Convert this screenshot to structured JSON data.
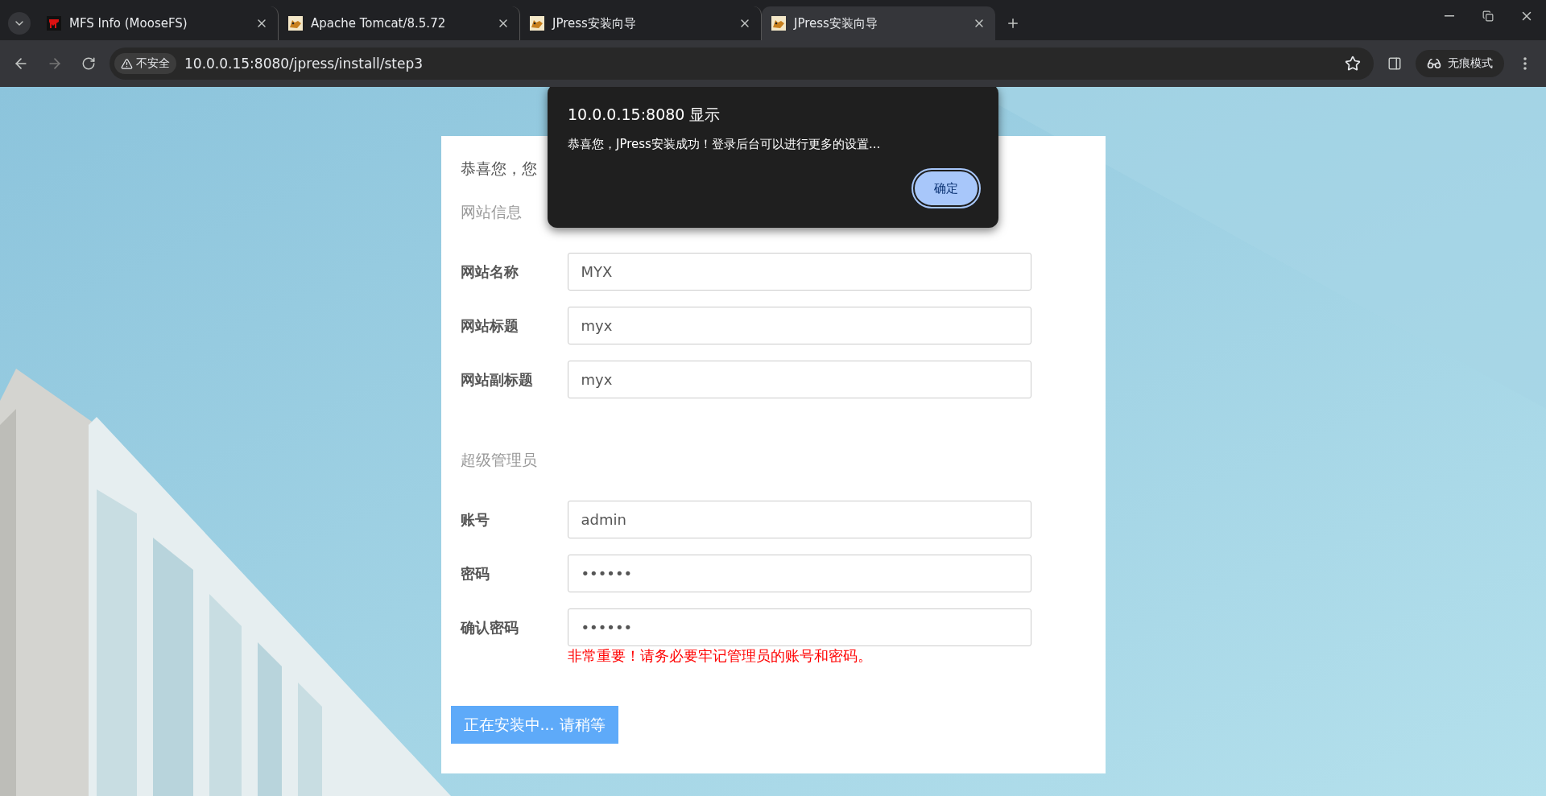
{
  "browser": {
    "tabs": [
      {
        "title": "MFS Info (MooseFS)",
        "kind": "mfs",
        "selected": false
      },
      {
        "title": "Apache Tomcat/8.5.72",
        "kind": "cat",
        "selected": false
      },
      {
        "title": "JPress安装向导",
        "kind": "cat",
        "selected": false
      },
      {
        "title": "JPress安装向导",
        "kind": "cat",
        "selected": true
      }
    ],
    "address": {
      "security_label": "不安全",
      "url": "10.0.0.15:8080/jpress/install/step3"
    },
    "profile_label": "无痕模式"
  },
  "page": {
    "intro": "恭喜您，您",
    "sections": [
      {
        "title": "网站信息",
        "fields": [
          {
            "label": "网站名称",
            "value": "MYX"
          },
          {
            "label": "网站标题",
            "value": "myx"
          },
          {
            "label": "网站副标题",
            "value": "myx"
          }
        ]
      },
      {
        "title": "超级管理员",
        "fields": [
          {
            "label": "账号",
            "value": "admin"
          },
          {
            "label": "密码",
            "value": "••••••"
          },
          {
            "label": "确认密码",
            "value": "••••••"
          }
        ],
        "note": "非常重要！请务必要牢记管理员的账号和密码。"
      }
    ],
    "submit_button": {
      "label": "正在安装中... 请稍等",
      "disabled": true
    }
  },
  "dialog": {
    "title": "10.0.0.15:8080 显示",
    "message": "恭喜您，JPress安装成功！登录后台可以进行更多的设置...",
    "ok_button": "确定"
  }
}
